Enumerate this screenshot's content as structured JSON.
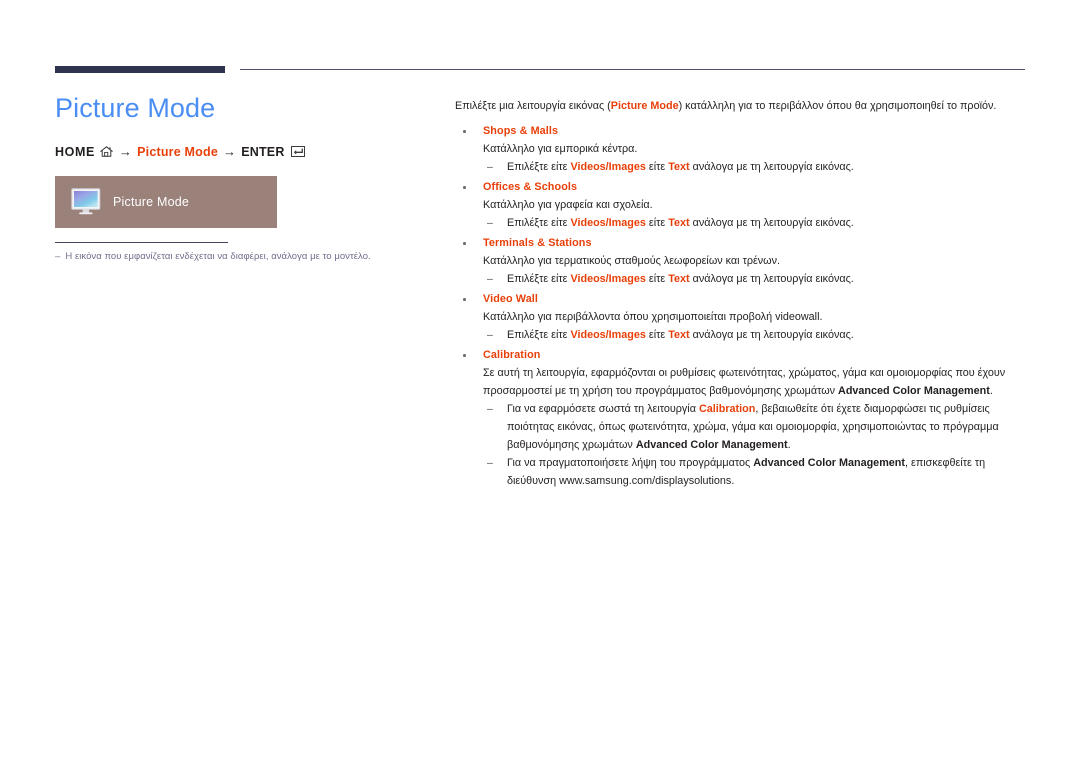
{
  "page": {
    "title": "Picture Mode",
    "breadcrumb": {
      "home_label": "HOME",
      "home_icon": "home-icon",
      "arrow1": "→",
      "menu_label": "Picture Mode",
      "arrow2": "→",
      "enter_label": "ENTER",
      "enter_icon": "enter-key-icon"
    },
    "menu_box": {
      "icon": "monitor-picture-mode-icon",
      "label": "Picture Mode"
    },
    "note": {
      "dash": "‒",
      "text": "Η εικόνα που εμφανίζεται ενδέχεται να διαφέρει, ανάλογα με το μοντέλο."
    }
  },
  "content": {
    "intro_pre": "Επιλέξτε μια λειτουργία εικόνας (",
    "intro_red": "Picture Mode",
    "intro_post": ") κατάλληλη για το περιβάλλον όπου θα χρησιμοποιηθεί το προϊόν.",
    "sub_pre": "Επιλέξτε είτε ",
    "sub_opt1": "Videos/Images",
    "sub_mid": " είτε ",
    "sub_opt2": "Text",
    "sub_post": " ανάλογα με τη λειτουργία εικόνας.",
    "items": [
      {
        "head": "Shops & Malls",
        "desc": "Κατάλληλο για εμπορικά κέντρα."
      },
      {
        "head": "Offices & Schools",
        "desc": "Κατάλληλο για γραφεία και σχολεία."
      },
      {
        "head": "Terminals & Stations",
        "desc": "Κατάλληλο για τερματικούς σταθμούς λεωφορείων και τρένων."
      },
      {
        "head": "Video Wall",
        "desc": "Κατάλληλο για περιβάλλοντα όπου χρησιμοποιείται προβολή videowall."
      }
    ],
    "calibration": {
      "head": "Calibration",
      "desc_pre": "Σε αυτή τη λειτουργία, εφαρμόζονται οι ρυθμίσεις φωτεινότητας, χρώματος, γάμα και ομοιομορφίας που έχουν προσαρμοστεί με τη χρήση του προγράμματος βαθμονόμησης χρωμάτων ",
      "desc_bold": "Advanced Color Management",
      "desc_post": ".",
      "sub1_pre": "Για να εφαρμόσετε σωστά τη λειτουργία ",
      "sub1_red": "Calibration",
      "sub1_mid": ", βεβαιωθείτε ότι έχετε διαμορφώσει τις ρυθμίσεις ποιότητας εικόνας, όπως φωτεινότητα, χρώμα, γάμα και ομοιομορφία, χρησιμοποιώντας το πρόγραμμα βαθμονόμησης χρωμάτων ",
      "sub1_bold": "Advanced Color Management",
      "sub1_post": ".",
      "sub2_pre": "Για να πραγματοποιήσετε λήψη του προγράμματος ",
      "sub2_bold": "Advanced Color Management",
      "sub2_post": ", επισκεφθείτε τη διεύθυνση www.samsung.com/displaysolutions."
    }
  },
  "colors": {
    "title_blue": "#4a8ef4",
    "accent_red": "#e8400a",
    "rule_navy": "#2e3350",
    "menu_box_brown": "#9a817a",
    "note_gray": "#6f6f8c"
  }
}
